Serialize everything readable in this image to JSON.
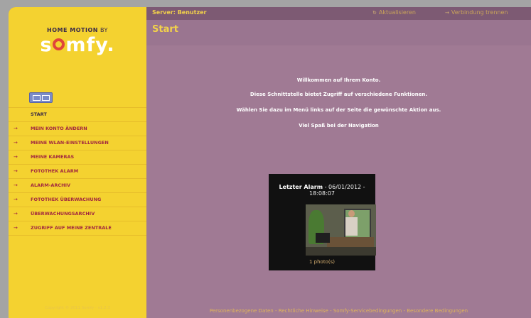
{
  "header": {
    "server_label": "Server: Benutzer",
    "refresh_label": "Aktualisieren",
    "disconnect_label": "Verbindung trennen"
  },
  "brand": {
    "tagline": "HOME MOTION",
    "by": " BY",
    "logo_pre": "s",
    "logo_post": "mfy."
  },
  "sidebar": {
    "items": [
      {
        "label": "START",
        "active": true
      },
      {
        "label": "MEIN KONTO ÄNDERN"
      },
      {
        "label": "MEINE WLAN-EINSTELLUNGEN"
      },
      {
        "label": "MEINE KAMERAS"
      },
      {
        "label": "FOTOTHEK ALARM"
      },
      {
        "label": "ALARM-ARCHIV"
      },
      {
        "label": "FOTOTHEK ÜBERWACHUNG"
      },
      {
        "label": "ÜBERWACHUNGSARCHIV"
      },
      {
        "label": "ZUGRIFF AUF MEINE ZENTRALE"
      }
    ],
    "copyright": "Copyright © 2011 Somfy - v1.2.3"
  },
  "main": {
    "title": "Start",
    "welcome_lines": [
      "Willkommen auf Ihrem Konto.",
      "Diese Schnittstelle bietet Zugriff auf verschiedene Funktionen.",
      "Wählen Sie dazu im Menü links auf der Seite die gewünschte Aktion aus.",
      "Viel Spaß bei der Navigation"
    ],
    "alarm": {
      "label": "Letzter Alarm",
      "datetime": " - 06/01/2012 - 18:08:07",
      "caption": "1 photo(s)"
    }
  },
  "footer": {
    "links": "Personenbezogene Daten - Rechtliche Hinweise - Somfy-Servicebedingungen - Besondere Bedingungen"
  },
  "colors": {
    "sidebar_bg": "#f4d230",
    "main_bg": "#a07a94",
    "accent_red": "#a2283f",
    "title_yellow": "#f3d24a"
  }
}
